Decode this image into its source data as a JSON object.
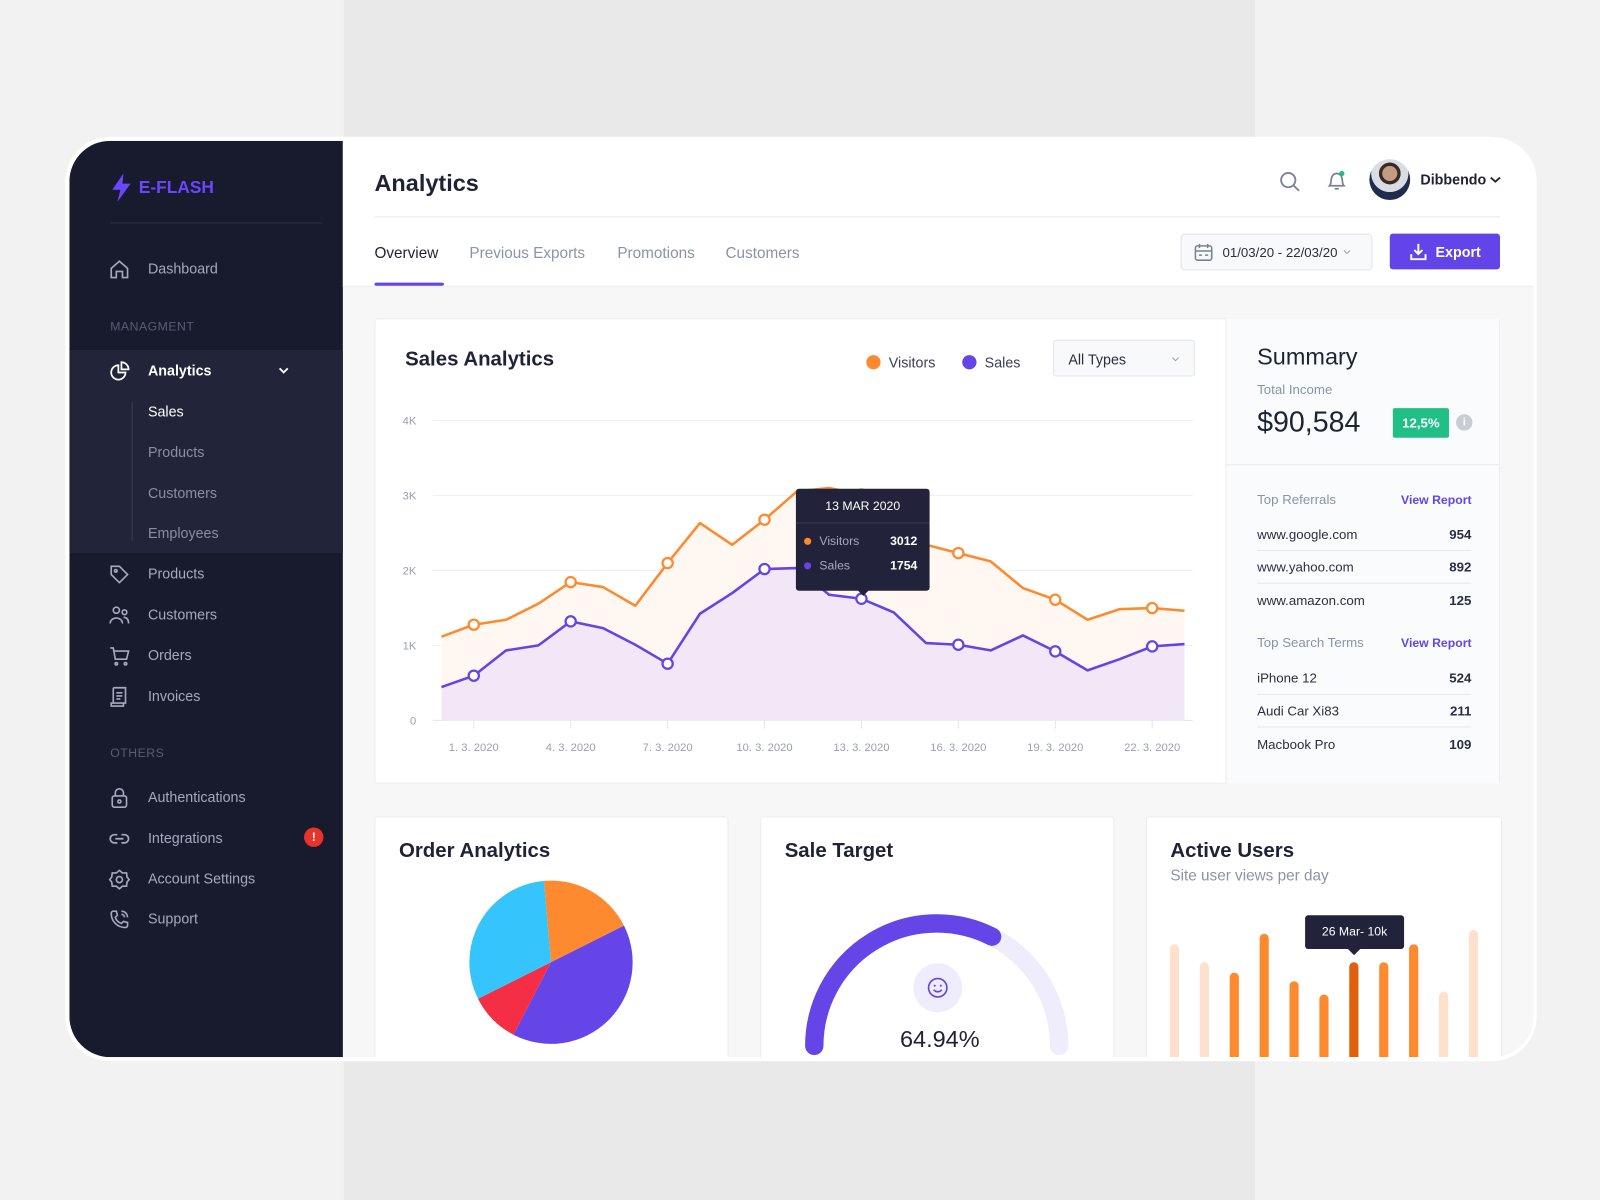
{
  "app": {
    "logo": "E-FLASH"
  },
  "sidebar": {
    "dashboard": "Dashboard",
    "section_management": "MANAGMENT",
    "analytics": {
      "label": "Analytics",
      "children": [
        "Sales",
        "Products",
        "Customers",
        "Employees"
      ],
      "active_child": "Sales"
    },
    "items": [
      "Products",
      "Customers",
      "Orders",
      "Invoices"
    ],
    "section_others": "OTHERS",
    "others": [
      "Authentications",
      "Integrations",
      "Account Settings",
      "Support"
    ],
    "integrations_badge": "!"
  },
  "header": {
    "title": "Analytics",
    "user_name": "Dibbendo",
    "notification_dot_color": "#1fbf86"
  },
  "tabs": [
    {
      "label": "Overview",
      "active": true
    },
    {
      "label": "Previous Exports"
    },
    {
      "label": "Promotions"
    },
    {
      "label": "Customers"
    }
  ],
  "toolbar": {
    "date_range": "01/03/20 - 22/03/20",
    "export_label": "Export"
  },
  "sales_analytics": {
    "title": "Sales Analytics",
    "legend": [
      {
        "name": "Visitors",
        "color": "#fd8a2e"
      },
      {
        "name": "Sales",
        "color": "#6543e8"
      }
    ],
    "filter": "All Types",
    "tooltip": {
      "date": "13 MAR 2020",
      "rows": [
        {
          "name": "Visitors",
          "value": "3012"
        },
        {
          "name": "Sales",
          "value": "1754"
        }
      ]
    }
  },
  "chart_data": [
    {
      "type": "line",
      "title": "Sales Analytics",
      "x": [
        "29.2.",
        "1.3.",
        "2.3.",
        "3.3.",
        "4.3.",
        "5.3.",
        "6.3.",
        "7.3.",
        "8.3.",
        "9.3.",
        "10.3.",
        "11.3.",
        "12.3.",
        "13.3.",
        "14.3.",
        "15.3.",
        "16.3.",
        "17.3.",
        "18.3.",
        "19.3.",
        "20.3.",
        "21.3.",
        "22.3.",
        "23.3."
      ],
      "x_tick_labels": [
        "1. 3. 2020",
        "4. 3. 2020",
        "7. 3. 2020",
        "10. 3. 2020",
        "13. 3. 2020",
        "16. 3. 2020",
        "19. 3. 2020",
        "22. 3. 2020"
      ],
      "y_tick_labels": [
        "0",
        "1K",
        "2K",
        "3K",
        "4K"
      ],
      "ylim": [
        0,
        4000
      ],
      "grid": true,
      "area_fill": true,
      "legend_position": "top-right",
      "series": [
        {
          "name": "Visitors",
          "color": "#fd8a2e",
          "values": [
            1116,
            1276,
            1342,
            1556,
            1844,
            1778,
            1529,
            2098,
            2631,
            2342,
            2676,
            3053,
            3098,
            3012,
            2600,
            2342,
            2231,
            2120,
            1764,
            1609,
            1342,
            1484,
            1498,
            1462
          ]
        },
        {
          "name": "Sales",
          "color": "#6543e8",
          "values": [
            444,
            596,
            933,
            1000,
            1320,
            1231,
            1009,
            756,
            1422,
            1698,
            2018,
            2031,
            1676,
            1622,
            1440,
            1031,
            1009,
            933,
            1133,
            920,
            667,
            818,
            987,
            1018
          ]
        }
      ]
    },
    {
      "type": "pie",
      "title": "Order Analytics",
      "slices": [
        {
          "value": 19,
          "color": "#fd8a2e"
        },
        {
          "value": 40,
          "color": "#6645e8"
        },
        {
          "value": 10,
          "color": "#f42e44"
        },
        {
          "value": 31,
          "color": "#35c5fc"
        }
      ]
    },
    {
      "type": "gauge",
      "title": "Sale Target",
      "value": 64.94,
      "label": "64.94%",
      "color": "#6645e8",
      "track_color": "#efedfc"
    },
    {
      "type": "bar",
      "title": "Active Users",
      "subtitle": "Site user views per day",
      "unit": "k",
      "values": [
        11.9,
        10,
        8.9,
        13,
        8,
        6.6,
        10,
        10,
        11.9,
        6.9,
        13.4
      ],
      "highlight_index": 6,
      "faded_indices": [
        0,
        1,
        9,
        10
      ],
      "tooltip": "26 Mar- 10k",
      "colors": {
        "bar": "#fd8a2e",
        "faded": "#fde1cd",
        "highlight": "#e05f0b"
      }
    }
  ],
  "summary": {
    "title": "Summary",
    "income_label": "Total Income",
    "income": "$90,584",
    "change": "12,5%",
    "referrals": {
      "title": "Top Referrals",
      "link": "View Report",
      "rows": [
        {
          "name": "www.google.com",
          "value": "954"
        },
        {
          "name": "www.yahoo.com",
          "value": "892"
        },
        {
          "name": "www.amazon.com",
          "value": "125"
        }
      ]
    },
    "search": {
      "title": "Top Search Terms",
      "link": "View Report",
      "rows": [
        {
          "name": "iPhone 12",
          "value": "524"
        },
        {
          "name": "Audi Car Xi83",
          "value": "211"
        },
        {
          "name": "Macbook Pro",
          "value": "109"
        }
      ]
    }
  }
}
